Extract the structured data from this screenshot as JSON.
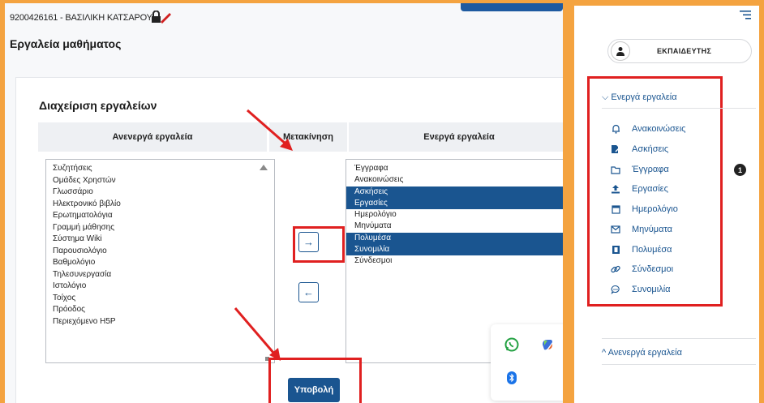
{
  "header": {
    "course_code_line": "9200426161 - ΒΑΣΙΛΙΚΗ ΚΑΤΣΑΡΟΥ",
    "page_title": "Εργαλεία μαθήματος"
  },
  "tools_manager": {
    "title": "Διαχείριση εργαλείων",
    "col_inactive": "Ανενεργά εργαλεία",
    "col_move": "Μετακίνηση",
    "col_active": "Ενεργά εργαλεία",
    "inactive_tools": [
      "Συζητήσεις",
      "Ομάδες Χρηστών",
      "Γλωσσάριο",
      "Ηλεκτρονικό βιβλίο",
      "Ερωτηματολόγια",
      "Γραμμή μάθησης",
      "Σύστημα Wiki",
      "Παρουσιολόγιο",
      "Βαθμολόγιο",
      "Τηλεσυνεργασία",
      "Ιστολόγιο",
      "Τοίχος",
      "Πρόοδος",
      "Περιεχόμενο H5P"
    ],
    "active_tools": [
      {
        "label": "Έγγραφα",
        "selected": false
      },
      {
        "label": "Ανακοινώσεις",
        "selected": false
      },
      {
        "label": "Ασκήσεις",
        "selected": true
      },
      {
        "label": "Εργασίες",
        "selected": true
      },
      {
        "label": "Ημερολόγιο",
        "selected": false
      },
      {
        "label": "Μηνύματα",
        "selected": false
      },
      {
        "label": "Πολυμέσα",
        "selected": true
      },
      {
        "label": "Συνομιλία",
        "selected": true
      },
      {
        "label": "Σύνδεσμοι",
        "selected": false
      }
    ],
    "move_right_glyph": "→",
    "move_left_glyph": "←",
    "submit_label": "Υποβολή"
  },
  "sidebar": {
    "role_label": "ΕΚΠΑΙΔΕΥΤΗΣ",
    "active_section": "Ενεργά εργαλεία",
    "inactive_section": "Ανενεργά εργαλεία",
    "active_tools": [
      {
        "label": "Ανακοινώσεις",
        "icon": "bell-icon"
      },
      {
        "label": "Ασκήσεις",
        "icon": "edit-file-icon"
      },
      {
        "label": "Έγγραφα",
        "icon": "folder-icon"
      },
      {
        "label": "Εργασίες",
        "icon": "upload-icon"
      },
      {
        "label": "Ημερολόγιο",
        "icon": "calendar-icon"
      },
      {
        "label": "Μηνύματα",
        "icon": "envelope-icon"
      },
      {
        "label": "Πολυμέσα",
        "icon": "film-icon"
      },
      {
        "label": "Σύνδεσμοι",
        "icon": "link-icon"
      },
      {
        "label": "Συνομιλία",
        "icon": "chat-icon"
      }
    ],
    "badge_count": "1"
  },
  "colors": {
    "primary": "#1a5590",
    "highlight": "#e02020",
    "background_border": "#f4a340"
  }
}
